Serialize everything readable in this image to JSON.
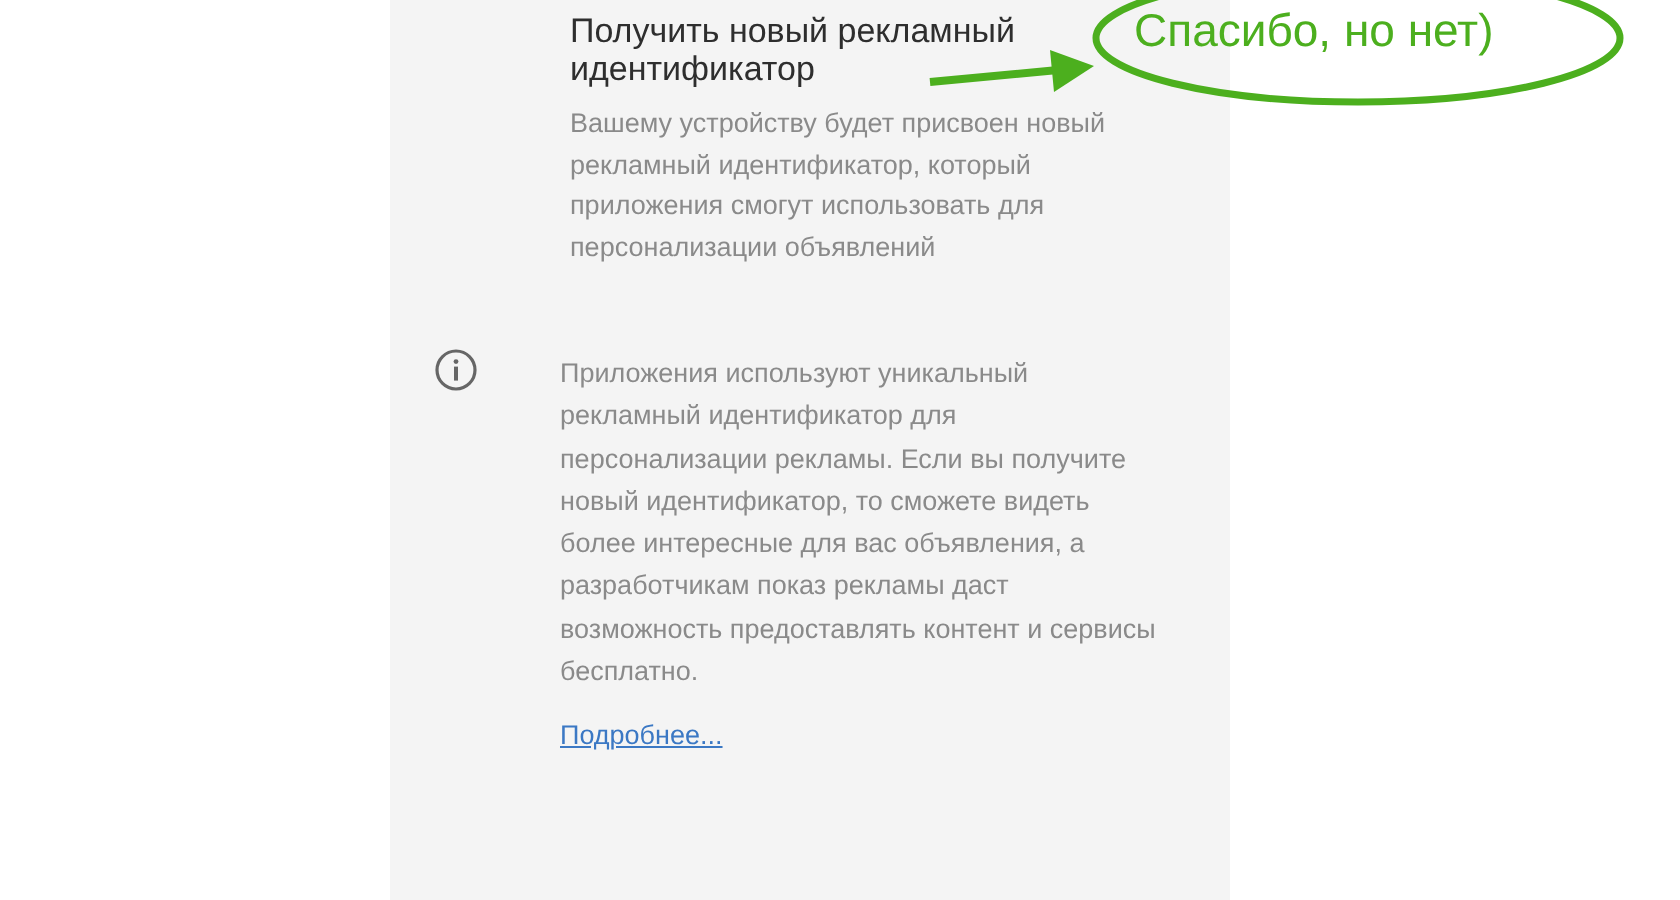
{
  "option": {
    "title": "Получить новый рекламный идентификатор",
    "description": "Вашему устройству будет присвоен новый рекламный идентификатор, который приложения смогут использовать для персонализации объявлений"
  },
  "info": {
    "text": "Приложения используют уникальный рекламный идентификатор для персонализации рекламы. Если вы получите новый идентификатор, то сможете видеть более интересные для вас объявления, а разработчикам показ рекламы даст возможность предоставлять контент и сервисы бесплатно.",
    "link": "Подробнее..."
  },
  "annotation": {
    "text": "Спасибо, но нет)"
  }
}
